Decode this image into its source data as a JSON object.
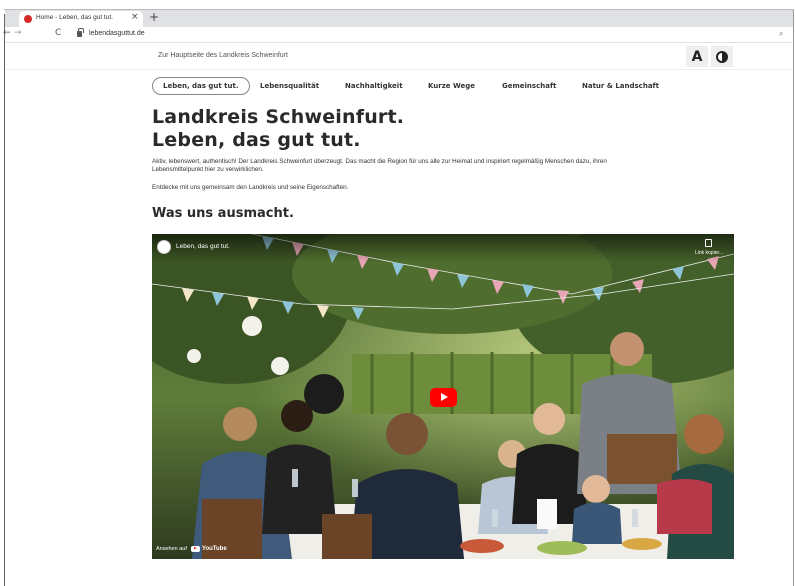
{
  "browser": {
    "tab_title": "Home - Leben, das gut tut.",
    "tab_close": "×",
    "new_tab": "+",
    "back": "←",
    "forward": "→",
    "reload": "C",
    "url": "lebendasguttut.de",
    "zoom_glyph": "⌕"
  },
  "header": {
    "home_link": "Zur Hauptseite des Landkreis Schweinfurt",
    "font_size_button": "A"
  },
  "nav": {
    "items": [
      {
        "label": "Leben, das gut tut."
      },
      {
        "label": "Lebensqualität"
      },
      {
        "label": "Nachhaltigkeit"
      },
      {
        "label": "Kurze Wege"
      },
      {
        "label": "Gemeinschaft"
      },
      {
        "label": "Natur & Landschaft"
      }
    ]
  },
  "content": {
    "title_line1": "Landkreis Schweinfurt.",
    "title_line2": "Leben, das gut tut.",
    "intro": "Aktiv, lebenswert, authentisch! Der Landkreis Schweinfurt überzeugt. Das macht die Region für uns alle zur Heimat und inspiriert regelmäßig Menschen dazu, ihren Lebensmittelpunkt hier zu verwirklichen.",
    "intro2": "Entdecke mit uns gemeinsam den Landkreis und seine Eigenschaften.",
    "section_title": "Was uns ausmacht."
  },
  "video": {
    "title": "Leben, das gut tut.",
    "copy_label": "Link kopier...",
    "watch_on": "Ansehen auf",
    "youtube": "YouTube"
  },
  "colors": {
    "accent_red": "#d62828",
    "youtube_red": "#ff0000"
  }
}
